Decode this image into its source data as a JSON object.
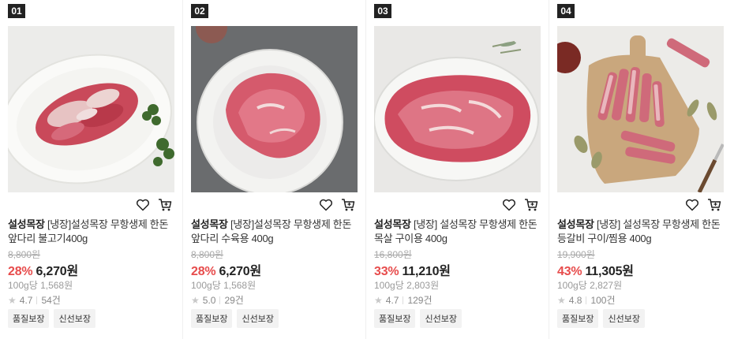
{
  "products": [
    {
      "rank": "01",
      "brand": "설성목장",
      "name": "[냉장]설성목장 무항생제 한돈 앞다리 불고기400g",
      "original_price": "8,800원",
      "discount_rate": "28%",
      "price": "6,270원",
      "unit_price": "100g당 1,568원",
      "rating": "4.7",
      "review_count": "54건",
      "tags": [
        "품질보장",
        "신선보장"
      ]
    },
    {
      "rank": "02",
      "brand": "설성목장",
      "name": "[냉장]설성목장 무항생제 한돈 앞다리 수육용 400g",
      "original_price": "8,800원",
      "discount_rate": "28%",
      "price": "6,270원",
      "unit_price": "100g당 1,568원",
      "rating": "5.0",
      "review_count": "29건",
      "tags": [
        "품질보장",
        "신선보장"
      ]
    },
    {
      "rank": "03",
      "brand": "설성목장",
      "name": "[냉장] 설성목장 무항생제 한돈 목살 구이용 400g",
      "original_price": "16,800원",
      "discount_rate": "33%",
      "price": "11,210원",
      "unit_price": "100g당 2,803원",
      "rating": "4.7",
      "review_count": "129건",
      "tags": [
        "품질보장",
        "신선보장"
      ]
    },
    {
      "rank": "04",
      "brand": "설성목장",
      "name": "[냉장] 설성목장 무항생제 한돈 등갈비 구이/찜용 400g",
      "original_price": "19,900원",
      "discount_rate": "43%",
      "price": "11,305원",
      "unit_price": "100g당 2,827원",
      "rating": "4.8",
      "review_count": "100건",
      "tags": [
        "품질보장",
        "신선보장"
      ]
    }
  ],
  "icons": {
    "wishlist": "heart-icon",
    "cart": "cart-icon",
    "rating": "star-icon"
  },
  "colors": {
    "discount": "#e74c4c",
    "rank_bg": "#222222",
    "tag_bg": "#f2f2f2"
  }
}
